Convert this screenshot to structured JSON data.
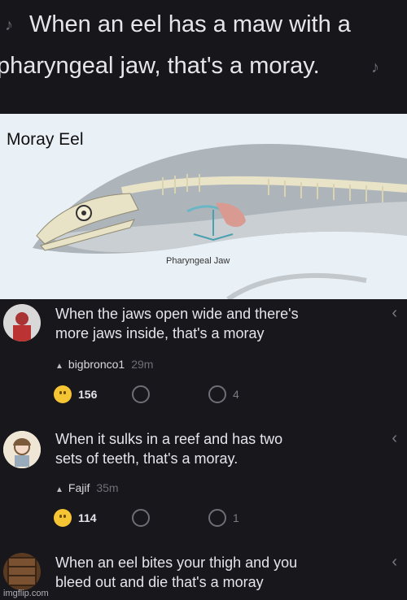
{
  "header": {
    "line1": "When an eel has a maw with a",
    "line2": "pharyngeal jaw, that's a moray.",
    "note_icon": "music-note-icon"
  },
  "diagram": {
    "title": "Moray Eel",
    "jaw_label": "Pharyngeal Jaw"
  },
  "comments": [
    {
      "text1": "When the jaws open wide and there's",
      "text2": "more jaws inside, that's a moray",
      "user": "bigbronco1",
      "time": "29m",
      "likes": "156",
      "replies": "4"
    },
    {
      "text1": "When it sulks in a reef and has two",
      "text2": "sets of teeth, that's a moray.",
      "user": "Fajif",
      "time": "35m",
      "likes": "114",
      "replies": "1"
    },
    {
      "text1": "When an eel bites your thigh and you",
      "text2": "bleed out and die that's a moray"
    }
  ],
  "watermark": "imgflip.com"
}
